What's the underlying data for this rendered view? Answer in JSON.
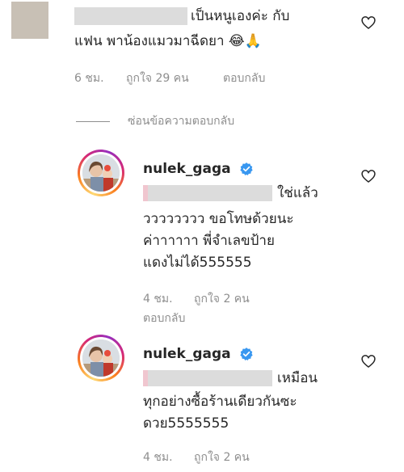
{
  "comments": [
    {
      "line1": "เป็นหนูเองค่ะ กับ",
      "line2": "แฟน พาน้องแมวมาฉีดยา 😂🙏",
      "time": "6 ชม.",
      "likes": "ถูกใจ 29 คน",
      "reply": "ตอบกลับ"
    }
  ],
  "hide_replies": "ซ่อนข้อความตอบกลับ",
  "replies": [
    {
      "username": "nulek_gaga",
      "lines": [
        "ใช่แล้ว",
        "วววววววว ขอโทษด้วยนะ",
        "ค่าาาาาา พี่จำเลขป้าย",
        "แดงไม่ได้555555"
      ],
      "time": "4 ชม.",
      "likes": "ถูกใจ 2 คน",
      "reply": "ตอบกลับ"
    },
    {
      "username": "nulek_gaga",
      "lines": [
        "เหมือน",
        "ทุกอย่างซื้อร้านเดียวกันซะ",
        "ดวย5555555"
      ],
      "time": "4 ชม.",
      "likes": "ถูกใจ 2 คน"
    }
  ],
  "icons": {
    "like": "heart-outline-icon",
    "verified": "verified-badge-icon"
  },
  "colors": {
    "text": "#262626",
    "secondary": "#8e8e8e",
    "verified": "#3897f0",
    "redaction": "#dcdcdc"
  }
}
